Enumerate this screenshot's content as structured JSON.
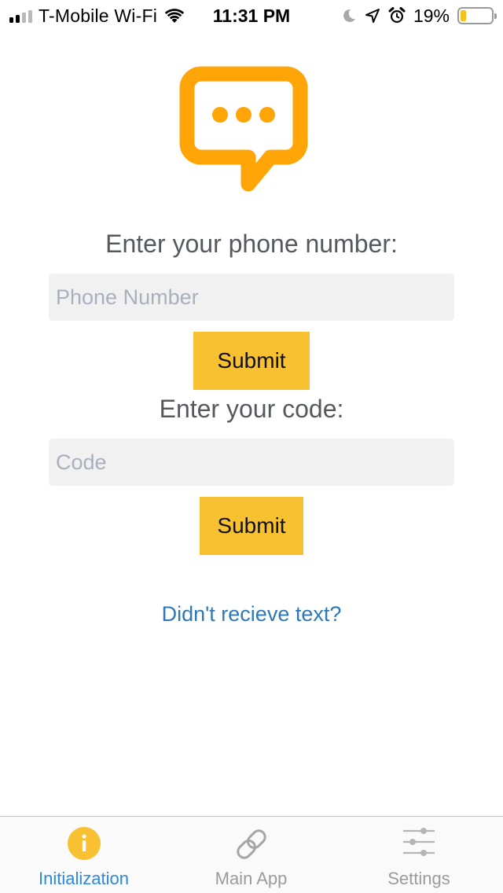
{
  "status_bar": {
    "carrier": "T-Mobile Wi-Fi",
    "time": "11:31 PM",
    "battery_percent": "19%",
    "battery_level": 0.19,
    "signal_bars_filled": 2,
    "signal_bars_total": 4,
    "icons": [
      "wifi-icon",
      "moon-icon",
      "location-arrow-icon",
      "alarm-icon"
    ]
  },
  "logo": {
    "icon": "chat-bubble-icon",
    "color": "#ffa508"
  },
  "form": {
    "phone_label": "Enter your phone number:",
    "phone_placeholder": "Phone Number",
    "phone_value": "",
    "submit_phone_label": "Submit",
    "code_label": "Enter your code:",
    "code_placeholder": "Code",
    "code_value": "",
    "submit_code_label": "Submit",
    "resend_link": "Didn't recieve text?"
  },
  "tab_bar": {
    "active_index": 0,
    "tabs": [
      {
        "label": "Initialization",
        "icon": "info-icon"
      },
      {
        "label": "Main App",
        "icon": "link-icon"
      },
      {
        "label": "Settings",
        "icon": "sliders-icon"
      }
    ]
  },
  "colors": {
    "accent_yellow": "#f7c131",
    "logo_orange": "#ffa508",
    "link_blue": "#2f78b5",
    "tab_active": "#2f89d9",
    "tab_inactive": "#9b9b9b"
  }
}
